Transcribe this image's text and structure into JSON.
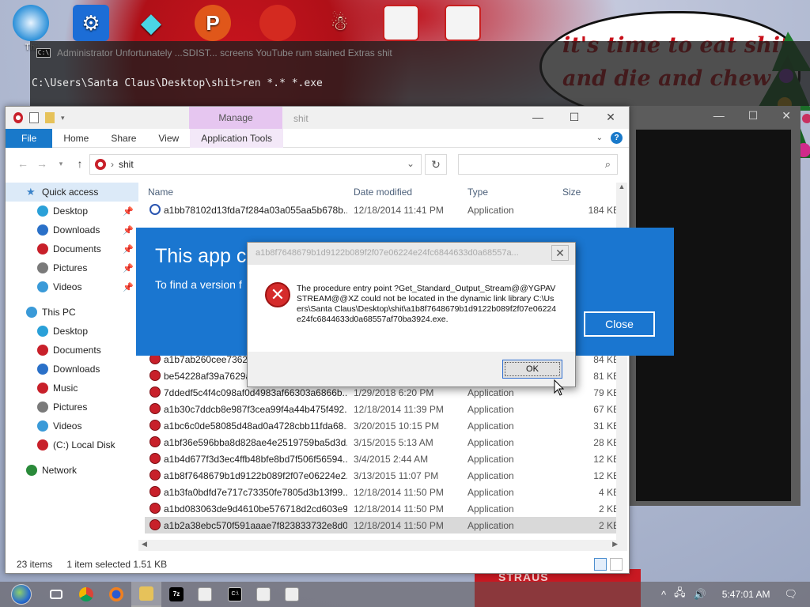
{
  "desktop": {
    "icons": [
      {
        "label": "Thi",
        "icon": "computer-icon"
      },
      {
        "label": "",
        "icon": "settings-gear-icon"
      },
      {
        "label": "",
        "icon": "diamond-icon"
      },
      {
        "label": "",
        "icon": "p-app-icon"
      },
      {
        "label": "",
        "icon": "angry-birds-icon"
      },
      {
        "label": "",
        "icon": "santa-icon"
      },
      {
        "label": "",
        "icon": "gift-icon"
      },
      {
        "label": "",
        "icon": "gift-icon"
      }
    ],
    "bubble_text": "it's time to eat shit and die and chew",
    "bottom_banner": "STRAUS"
  },
  "cmd": {
    "title_fragments": "Administrator    Unfortunately    ...SDIST... screens    YouTube    rum stained    Extras    shit",
    "command_line": "C:\\Users\\Santa Claus\\Desktop\\shit>ren *.* *.exe"
  },
  "explorer": {
    "title": "shit",
    "manage_tab": "Manage",
    "window_controls": {
      "minimize": "—",
      "maximize": "☐",
      "close": "✕"
    },
    "ribbon_tabs": [
      "File",
      "Home",
      "Share",
      "View",
      "Application Tools"
    ],
    "address": {
      "crumb_sep": "›",
      "path": "shit"
    },
    "columns": {
      "name": "Name",
      "date": "Date modified",
      "type": "Type",
      "size": "Size"
    },
    "nav": [
      {
        "label": "Quick access",
        "icon": "star-icon",
        "indent": 0,
        "pinned": false,
        "selected": true
      },
      {
        "label": "Desktop",
        "icon": "desktop-icon",
        "indent": 1,
        "pinned": true
      },
      {
        "label": "Downloads",
        "icon": "downloads-icon",
        "indent": 1,
        "pinned": true
      },
      {
        "label": "Documents",
        "icon": "documents-icon",
        "indent": 1,
        "pinned": true
      },
      {
        "label": "Pictures",
        "icon": "pictures-icon",
        "indent": 1,
        "pinned": true
      },
      {
        "label": "Videos",
        "icon": "videos-icon",
        "indent": 1,
        "pinned": true
      },
      {
        "label": "",
        "icon": "",
        "indent": 0,
        "spacer": true
      },
      {
        "label": "This PC",
        "icon": "this-pc-icon",
        "indent": 0,
        "pinned": false
      },
      {
        "label": "Desktop",
        "icon": "desktop-icon",
        "indent": 1
      },
      {
        "label": "Documents",
        "icon": "documents-icon",
        "indent": 1
      },
      {
        "label": "Downloads",
        "icon": "downloads-icon",
        "indent": 1
      },
      {
        "label": "Music",
        "icon": "music-icon",
        "indent": 1
      },
      {
        "label": "Pictures",
        "icon": "pictures-icon",
        "indent": 1
      },
      {
        "label": "Videos",
        "icon": "videos-icon",
        "indent": 1
      },
      {
        "label": "(C:) Local Disk",
        "icon": "disk-icon",
        "indent": 1
      },
      {
        "label": "",
        "icon": "",
        "indent": 0,
        "spacer": true
      },
      {
        "label": "Network",
        "icon": "network-icon",
        "indent": 0
      }
    ],
    "files": [
      {
        "name": "a1bb78102d13fda7f284a03a055aa5b678b...",
        "date": "12/18/2014 11:41 PM",
        "type": "Application",
        "size": "184 KB",
        "icon": "ie"
      },
      {
        "name": "",
        "date": "",
        "type": "",
        "size": "",
        "hidden": true
      },
      {
        "name": "",
        "date": "",
        "type": "",
        "size": "",
        "hidden": true
      },
      {
        "name": "",
        "date": "",
        "type": "",
        "size": "",
        "hidden": true
      },
      {
        "name": "",
        "date": "",
        "type": "",
        "size": "",
        "hidden": true
      },
      {
        "name": "",
        "date": "",
        "type": "",
        "size": "",
        "hidden": true
      },
      {
        "name": "",
        "date": "",
        "type": "",
        "size": "",
        "hidden": true
      },
      {
        "name": "",
        "date": "",
        "type": "",
        "size": "",
        "hidden": true
      },
      {
        "name": "",
        "date": "",
        "type": "",
        "size": "",
        "hidden": true
      },
      {
        "name": "a1b7ab260cee7362a",
        "date": "",
        "type": "",
        "size": "84 KB"
      },
      {
        "name": "be54228af39a7629a7",
        "date": "",
        "type": "",
        "size": "81 KB"
      },
      {
        "name": "7ddedf5c4f4c098af0d4983af66303a6866b...",
        "date": "1/29/2018 6:20 PM",
        "type": "Application",
        "size": "79 KB"
      },
      {
        "name": "a1b30c7ddcb8e987f3cea99f4a44b475f492...",
        "date": "12/18/2014 11:39 PM",
        "type": "Application",
        "size": "67 KB"
      },
      {
        "name": "a1bc6c0de58085d48ad0a4728cbb11fda68...",
        "date": "3/20/2015 10:15 PM",
        "type": "Application",
        "size": "31 KB"
      },
      {
        "name": "a1bf36e596bba8d828ae4e2519759ba5d3d...",
        "date": "3/15/2015 5:13 AM",
        "type": "Application",
        "size": "28 KB"
      },
      {
        "name": "a1b4d677f3d3ec4ffb48bfe8bd7f506f56594...",
        "date": "3/4/2015 2:44 AM",
        "type": "Application",
        "size": "12 KB"
      },
      {
        "name": "a1b8f7648679b1d9122b089f2f07e06224e2...",
        "date": "3/13/2015 11:07 PM",
        "type": "Application",
        "size": "12 KB"
      },
      {
        "name": "a1b3fa0bdfd7e717c73350fe7805d3b13f99...",
        "date": "12/18/2014 11:50 PM",
        "type": "Application",
        "size": "4 KB"
      },
      {
        "name": "a1bd083063de9d4610be576718d2cd603e9...",
        "date": "12/18/2014 11:50 PM",
        "type": "Application",
        "size": "2 KB"
      },
      {
        "name": "a1b2a38ebc570f591aaae7f823833732e8d0...",
        "date": "12/18/2014 11:50 PM",
        "type": "Application",
        "size": "2 KB",
        "selected": true
      }
    ],
    "status": {
      "count": "23 items",
      "selection": "1 item selected  1.51 KB"
    }
  },
  "blue_dialog": {
    "title": "This app c",
    "subtitle": "To find a version f",
    "close_label": "Close"
  },
  "error_dialog": {
    "title": "a1b8f7648679b1d9122b089f2f07e06224e24fc6844633d0a68557a...",
    "close_glyph": "✕",
    "message": "The procedure entry point ?Get_Standard_Output_Stream@@YGPAVSTREAM@@XZ could not be located in the dynamic link library C:\\Users\\Santa Claus\\Desktop\\shit\\a1b8f7648679b1d9122b089f2f07e06224e24fc6844633d0a68557af70ba3924.exe.",
    "ok_label": "OK"
  },
  "taskbar": {
    "items": [
      {
        "icon": "start-orb-icon"
      },
      {
        "icon": "task-view-icon"
      },
      {
        "icon": "chrome-icon"
      },
      {
        "icon": "firefox-icon"
      },
      {
        "icon": "file-explorer-icon",
        "active": true
      },
      {
        "icon": "7zip-icon"
      },
      {
        "icon": "app-window-icon"
      },
      {
        "icon": "cmd-icon"
      },
      {
        "icon": "app-window-icon"
      },
      {
        "icon": "app-window-icon"
      }
    ],
    "tray_chevron": "^",
    "clock": "5:47:01 AM"
  },
  "colors": {
    "accent": "#1979ca",
    "dialog_blue": "#1a76d0",
    "error_red": "#d52b2b",
    "manage_tab": "#e6c6f0"
  }
}
